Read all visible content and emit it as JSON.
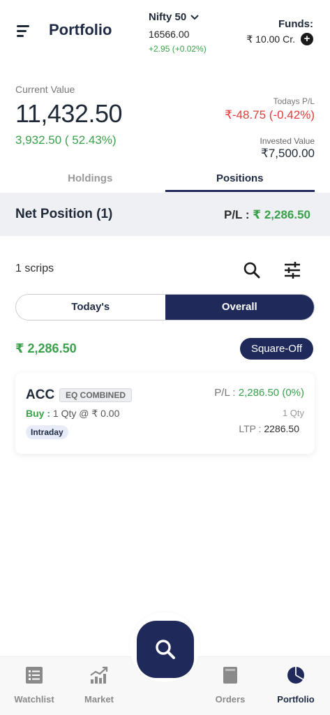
{
  "header": {
    "title": "Portfolio",
    "index_name": "Nifty 50",
    "index_value": "16566.00",
    "index_change": "+2.95 (+0.02%)",
    "funds_label": "Funds:",
    "funds_value": "₹ 10.00 Cr."
  },
  "summary": {
    "current_value_label": "Current Value",
    "current_value": "11,432.50",
    "current_change": "3,932.50 ( 52.43%)",
    "todays_pl_label": "Todays P/L",
    "todays_pl_value": "₹-48.75 (-0.42%)",
    "invested_label": "Invested Value",
    "invested_value": "₹7,500.00"
  },
  "tabs": [
    {
      "label": "Holdings"
    },
    {
      "label": "Positions"
    }
  ],
  "net_position": {
    "title": "Net Position (1)",
    "pl_label": "P/L :",
    "pl_value": "₹ 2,286.50"
  },
  "list": {
    "scrips_label": "1 scrips",
    "toggle_today": "Today's",
    "toggle_overall": "Overall",
    "total_pl": "₹ 2,286.50",
    "squareoff_label": "Square-Off"
  },
  "positions": [
    {
      "symbol": "ACC",
      "segment": "EQ COMBINED",
      "side_label": "Buy :",
      "order_detail": "1 Qty @ ₹ 0.00",
      "product": "Intraday",
      "pl_label": "P/L :",
      "pl_value": "2,286.50 (0%)",
      "qty": "1 Qty",
      "ltp_label": "LTP :",
      "ltp_value": "2286.50"
    }
  ],
  "bottom_nav": [
    {
      "label": "Watchlist",
      "icon": "list-icon"
    },
    {
      "label": "Market",
      "icon": "chart-icon"
    },
    {
      "label": "Orders",
      "icon": "book-icon"
    },
    {
      "label": "Portfolio",
      "icon": "pie-chart-icon"
    }
  ],
  "colors": {
    "primary": "#1f2a5a",
    "positive": "#3aa04a",
    "negative": "#e23b3b"
  }
}
